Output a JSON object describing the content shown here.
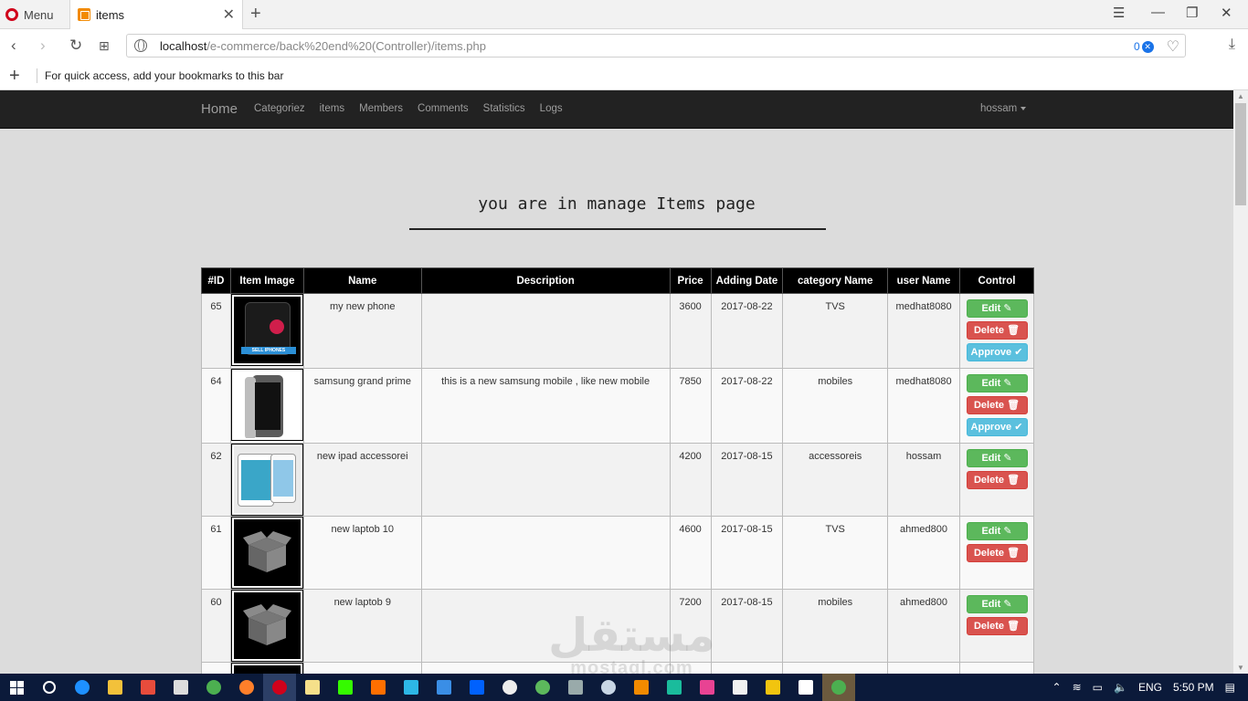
{
  "browser": {
    "menu_label": "Menu",
    "tab_title": "items",
    "url_host": "localhost",
    "url_path": "/e-commerce/back%20end%20(Controller)/items.php",
    "adblock_count": "0",
    "bookmarks_hint": "For quick access, add your bookmarks to this bar"
  },
  "navbar": {
    "brand": "Home",
    "links": [
      "Categoriez",
      "items",
      "Members",
      "Comments",
      "Statistics",
      "Logs"
    ],
    "user": "hossam"
  },
  "page": {
    "title": "you are in manage Items page"
  },
  "table": {
    "headers": [
      "#ID",
      "Item Image",
      "Name",
      "Description",
      "Price",
      "Adding Date",
      "category Name",
      "user Name",
      "Control"
    ],
    "rows": [
      {
        "id": "65",
        "image": "black-phone",
        "name": "my new phone",
        "description": "",
        "price": "3600",
        "date": "2017-08-22",
        "category": "TVS",
        "user": "medhat8080",
        "approve": true
      },
      {
        "id": "64",
        "image": "gray-phone",
        "name": "samsung grand prime",
        "description": "this is a new samsung mobile , like new mobile",
        "price": "7850",
        "date": "2017-08-22",
        "category": "mobiles",
        "user": "medhat8080",
        "approve": true
      },
      {
        "id": "62",
        "image": "ipad",
        "name": "new ipad accessorei",
        "description": "",
        "price": "4200",
        "date": "2017-08-15",
        "category": "accessoreis",
        "user": "hossam",
        "approve": false
      },
      {
        "id": "61",
        "image": "box",
        "name": "new laptob 10",
        "description": "",
        "price": "4600",
        "date": "2017-08-15",
        "category": "TVS",
        "user": "ahmed800",
        "approve": false
      },
      {
        "id": "60",
        "image": "box",
        "name": "new laptob 9",
        "description": "",
        "price": "7200",
        "date": "2017-08-15",
        "category": "mobiles",
        "user": "ahmed800",
        "approve": false
      }
    ],
    "buttons": {
      "edit": "Edit",
      "delete": "Delete",
      "approve": "Approve"
    }
  },
  "watermark": {
    "arabic": "مستقل",
    "latin": "mostaql.com"
  },
  "taskbar": {
    "lang": "ENG",
    "time": "5:50 PM"
  },
  "colors": {
    "edit": "#5cb85c",
    "delete": "#d9534f",
    "approve": "#5bc0de",
    "navbar": "#222222"
  }
}
